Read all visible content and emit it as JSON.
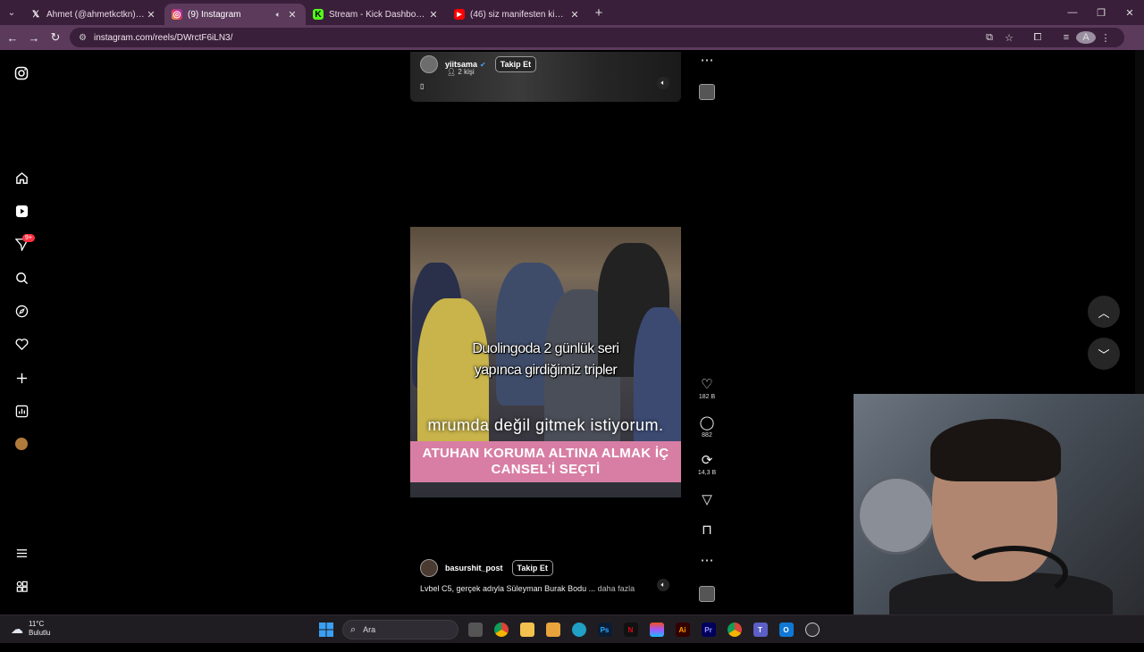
{
  "browser": {
    "tabs": [
      {
        "title": "Ahmet (@ahmetkctkn) / X",
        "favicon": "x-logo",
        "active": false
      },
      {
        "title": "(9) Instagram",
        "favicon": "instagram-logo",
        "active": true
      },
      {
        "title": "Stream - Kick Dashboard",
        "favicon": "kick-logo",
        "active": false
      },
      {
        "title": "(46) siz manifesten kimsiniz?😍",
        "favicon": "youtube-logo",
        "active": false
      }
    ],
    "url": "instagram.com/reels/DWrctF6iLN3/"
  },
  "sidebar": {
    "notification_badge": "9+",
    "items": [
      "instagram-icon",
      "home-icon",
      "reels-icon",
      "messages-icon",
      "search-icon",
      "explore-icon",
      "heart-icon",
      "create-icon",
      "dashboard-icon",
      "profile-avatar",
      "menu-icon",
      "more-apps-icon"
    ]
  },
  "reel_top": {
    "username": "yiitsama",
    "follow_label": "Takip Et",
    "people_count": "2 kişi"
  },
  "reel_main": {
    "caption_line1": "Duolingoda 2 günlük seri",
    "caption_line2": "yapınca girdiğimiz tripler",
    "subtitle": "mrumda değil gitmek istiyorum.",
    "banner_line1": "ATUHAN KORUMA ALTINA ALMAK İÇ",
    "banner_line2": "CANSEL'İ SEÇTİ",
    "username": "basurshit_post",
    "follow_label": "Takip Et",
    "description": "Lvbel C5, gerçek adıyla Süleyman Burak Bodu ...",
    "more_label": "daha fazla"
  },
  "actions": {
    "likes": "182 B",
    "comments": "882",
    "reposts": "14,3 B"
  },
  "taskbar": {
    "temperature": "11°C",
    "weather": "Bulutlu",
    "search_placeholder": "Ara"
  }
}
